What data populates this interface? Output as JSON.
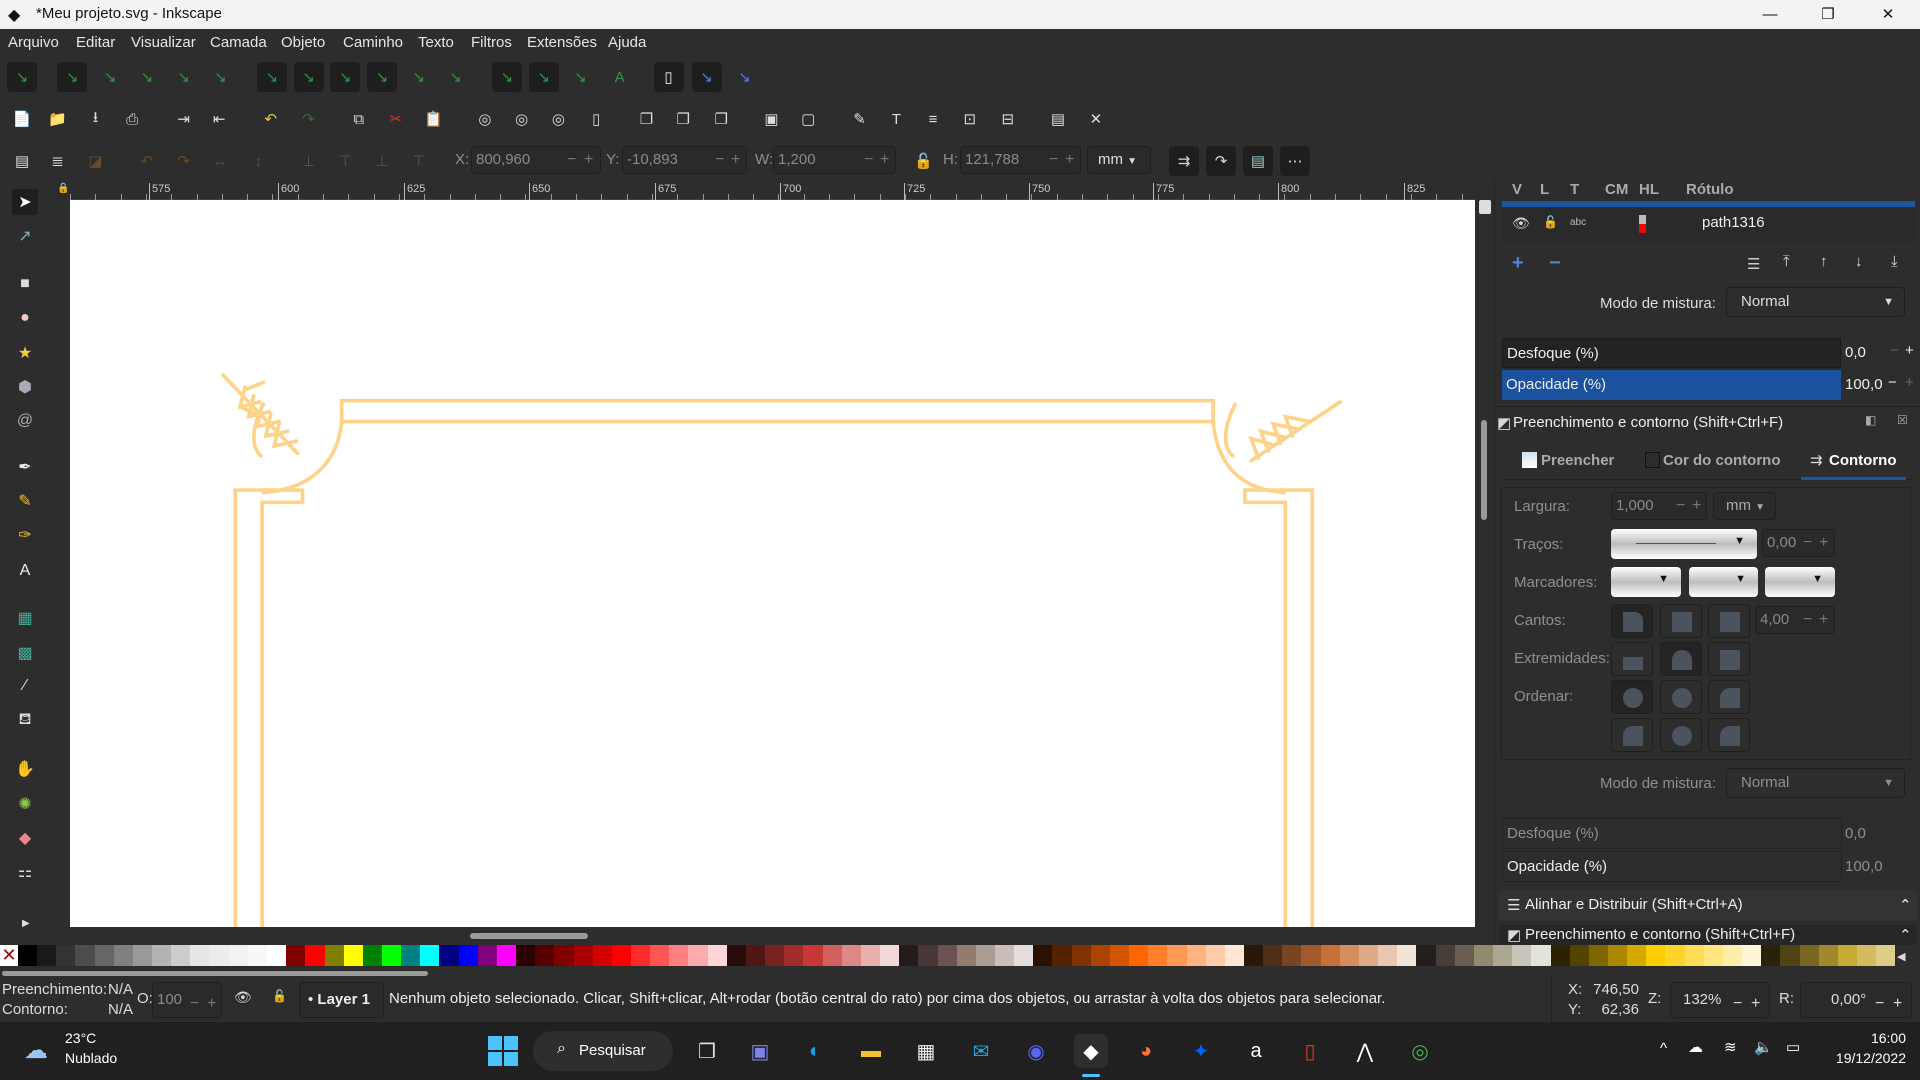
{
  "window": {
    "title": "*Meu projeto.svg - Inkscape",
    "minimize": "—",
    "maximize": "❐",
    "close": "✕"
  },
  "menu": [
    "Arquivo",
    "Editar",
    "Visualizar",
    "Camada",
    "Objeto",
    "Caminho",
    "Texto",
    "Filtros",
    "Extensões",
    "Ajuda"
  ],
  "toolbar_snap_icons": [
    "snap-toggle-icon",
    "snap-bbox-icon",
    "snap-bbox-edge-icon",
    "snap-bbox-corner-icon",
    "snap-bbox-midpoint-icon",
    "snap-bbox-center-icon",
    "snap-nodes-icon",
    "snap-path-icon",
    "snap-intersection-icon",
    "snap-cusp-icon",
    "snap-smooth-icon",
    "snap-line-midpoint-icon",
    "snap-others-icon",
    "snap-center-icon",
    "snap-rotation-center-icon",
    "snap-text-baseline-icon",
    "snap-page-icon",
    "snap-grid-icon",
    "snap-guide-icon"
  ],
  "toolbar_commands_icons": [
    "new-document-icon",
    "open-icon",
    "save-icon",
    "print-icon",
    "import-icon",
    "export-icon",
    "undo-icon",
    "redo-icon",
    "copy-icon",
    "cut-icon",
    "paste-icon",
    "zoom-selection-icon",
    "zoom-drawing-icon",
    "zoom-page-icon",
    "zoom-page-width-icon",
    "duplicate-icon",
    "clone-icon",
    "unlink-clone-icon",
    "group-icon",
    "ungroup-icon",
    "fill-stroke-icon",
    "text-font-icon",
    "layers-icon",
    "xml-editor-icon",
    "align-distribute-icon",
    "document-properties-icon",
    "preferences-icon"
  ],
  "toolbar_select_icons": [
    "select-all-icon",
    "select-all-layers-icon",
    "deselect-icon",
    "rotate-ccw-icon",
    "rotate-cw-icon",
    "flip-horizontal-icon",
    "flip-vertical-icon",
    "lower-bottom-icon",
    "lower-icon",
    "raise-icon",
    "raise-top-icon"
  ],
  "select_toolbar": {
    "x_label": "X:",
    "x": "800,960",
    "y_label": "Y:",
    "y": "-10,893",
    "w_label": "W:",
    "w": "1,200",
    "h_label": "H:",
    "h": "121,788",
    "unit": "mm",
    "minus": "−",
    "plus": "+"
  },
  "ruler_labels": [
    "575",
    "600",
    "625",
    "650",
    "675",
    "700",
    "725",
    "750",
    "775",
    "800",
    "825"
  ],
  "tools": [
    "selector-tool-icon",
    "node-tool-icon",
    "rectangle-tool-icon",
    "ellipse-tool-icon",
    "star-tool-icon",
    "3d-box-tool-icon",
    "spiral-tool-icon",
    "pen-tool-icon",
    "pencil-tool-icon",
    "calligraphy-tool-icon",
    "text-tool-icon",
    "gradient-tool-icon",
    "mesh-tool-icon",
    "dropper-tool-icon",
    "paint-bucket-tool-icon",
    "tweak-tool-icon",
    "spray-tool-icon",
    "eraser-tool-icon",
    "connector-tool-icon"
  ],
  "objects_panel": {
    "columns": [
      "V",
      "L",
      "T",
      "CM",
      "HL",
      "Rótulo"
    ],
    "row_label": "path1316",
    "highlight_color": "#ff0000",
    "add": "+",
    "remove": "−"
  },
  "layer_blend": {
    "label": "Modo de mistura:",
    "value": "Normal"
  },
  "layer_blur": {
    "label": "Desfoque (%)",
    "value": "0,0"
  },
  "layer_opacity": {
    "label": "Opacidade (%)",
    "value": "100,0"
  },
  "fill_stroke": {
    "title": "Preenchimento e contorno (Shift+Ctrl+F)",
    "tabs": [
      "Preencher",
      "Cor do contorno",
      "Contorno"
    ],
    "active_tab": "Contorno",
    "width_label": "Largura:",
    "width": "1,000",
    "width_unit": "mm",
    "dashes_label": "Traços:",
    "dash_offset": "0,00",
    "markers_label": "Marcadores:",
    "joins_label": "Cantos:",
    "miter": "4,00",
    "caps_label": "Extremidades:",
    "order_label": "Ordenar:",
    "blend_label": "Modo de mistura:",
    "blend": "Normal",
    "blur_label": "Desfoque (%)",
    "blur": "0,0",
    "opacity_label": "Opacidade (%)",
    "opacity": "100,0"
  },
  "align_panel": {
    "title": "Alinhar e Distribuir (Shift+Ctrl+A)"
  },
  "fill_stroke_2": {
    "title": "Preenchimento e contorno (Shift+Ctrl+F)"
  },
  "palette": [
    "#000000",
    "#1a1a1a",
    "#333333",
    "#4d4d4d",
    "#666666",
    "#808080",
    "#999999",
    "#b3b3b3",
    "#cccccc",
    "#e6e6e6",
    "#ececec",
    "#f2f2f2",
    "#f8f8f8",
    "#ffffff",
    "#800000",
    "#ff0000",
    "#808000",
    "#ffff00",
    "#008000",
    "#00ff00",
    "#008080",
    "#00ffff",
    "#000080",
    "#0000ff",
    "#800080",
    "#ff00ff",
    "#2b0000",
    "#550000",
    "#800000",
    "#aa0000",
    "#d40000",
    "#ff0000",
    "#ff2a2a",
    "#ff5555",
    "#ff8080",
    "#ffaaaa",
    "#ffd5d5",
    "#280b0b",
    "#501616",
    "#782121",
    "#a02c2c",
    "#c83737",
    "#d35f5f",
    "#de8787",
    "#e9afaf",
    "#f4d7d7",
    "#241c1c",
    "#483737",
    "#6c5353",
    "#917c6f",
    "#ac9d93",
    "#c8beb7",
    "#e3dedb",
    "#2b1100",
    "#552200",
    "#803300",
    "#aa4400",
    "#d45500",
    "#ff6600",
    "#ff7f2a",
    "#ff9955",
    "#ffb380",
    "#ffccaa",
    "#ffe6d5",
    "#28170b",
    "#502d16",
    "#784421",
    "#a05a2c",
    "#c87137",
    "#d38d5f",
    "#deaa87",
    "#e9c6af",
    "#f4e3d7",
    "#241f1c",
    "#483e37",
    "#6c5d53",
    "#918a6f",
    "#aca793",
    "#c8c4b7",
    "#e3e2db",
    "#2b2200",
    "#554400",
    "#806600",
    "#aa8800",
    "#d4aa00",
    "#ffcc00",
    "#ffd42a",
    "#ffdd55",
    "#ffe680",
    "#ffeeaa",
    "#fff6d5",
    "#28220b",
    "#504416",
    "#786721",
    "#a0892c",
    "#c8ab37",
    "#d3bc5f",
    "#decd87"
  ],
  "status": {
    "fill_label": "Preenchimento:",
    "fill": "N/A",
    "stroke_label": "Contorno:",
    "stroke": "N/A",
    "opacity_label": "O:",
    "opacity": "100",
    "layer": "Layer 1",
    "message": "Nenhum objeto selecionado. Clicar, Shift+clicar, Alt+rodar (botão central do rato) por cima dos objetos, ou arrastar à volta dos objetos para selecionar.",
    "x_label": "X:",
    "x": "746,50",
    "y_label": "Y:",
    "y": "62,36",
    "zoom_label": "Z:",
    "zoom": "132%",
    "rotation_label": "R:",
    "rotation": "0,00°"
  },
  "taskbar": {
    "weather_temp": "23°C",
    "weather_desc": "Nublado",
    "search": "Pesquisar",
    "time": "16:00",
    "date": "19/12/2022",
    "apps": [
      "task-view-icon",
      "teams-chat-icon",
      "edge-icon",
      "file-explorer-icon",
      "microsoft-store-icon",
      "mail-icon",
      "discord-icon",
      "inkscape-icon",
      "firefox-icon",
      "dropbox-icon",
      "amazon-icon",
      "office-icon",
      "app-icon",
      "chrome-icon"
    ]
  },
  "artwork_color": "#fdd38a"
}
